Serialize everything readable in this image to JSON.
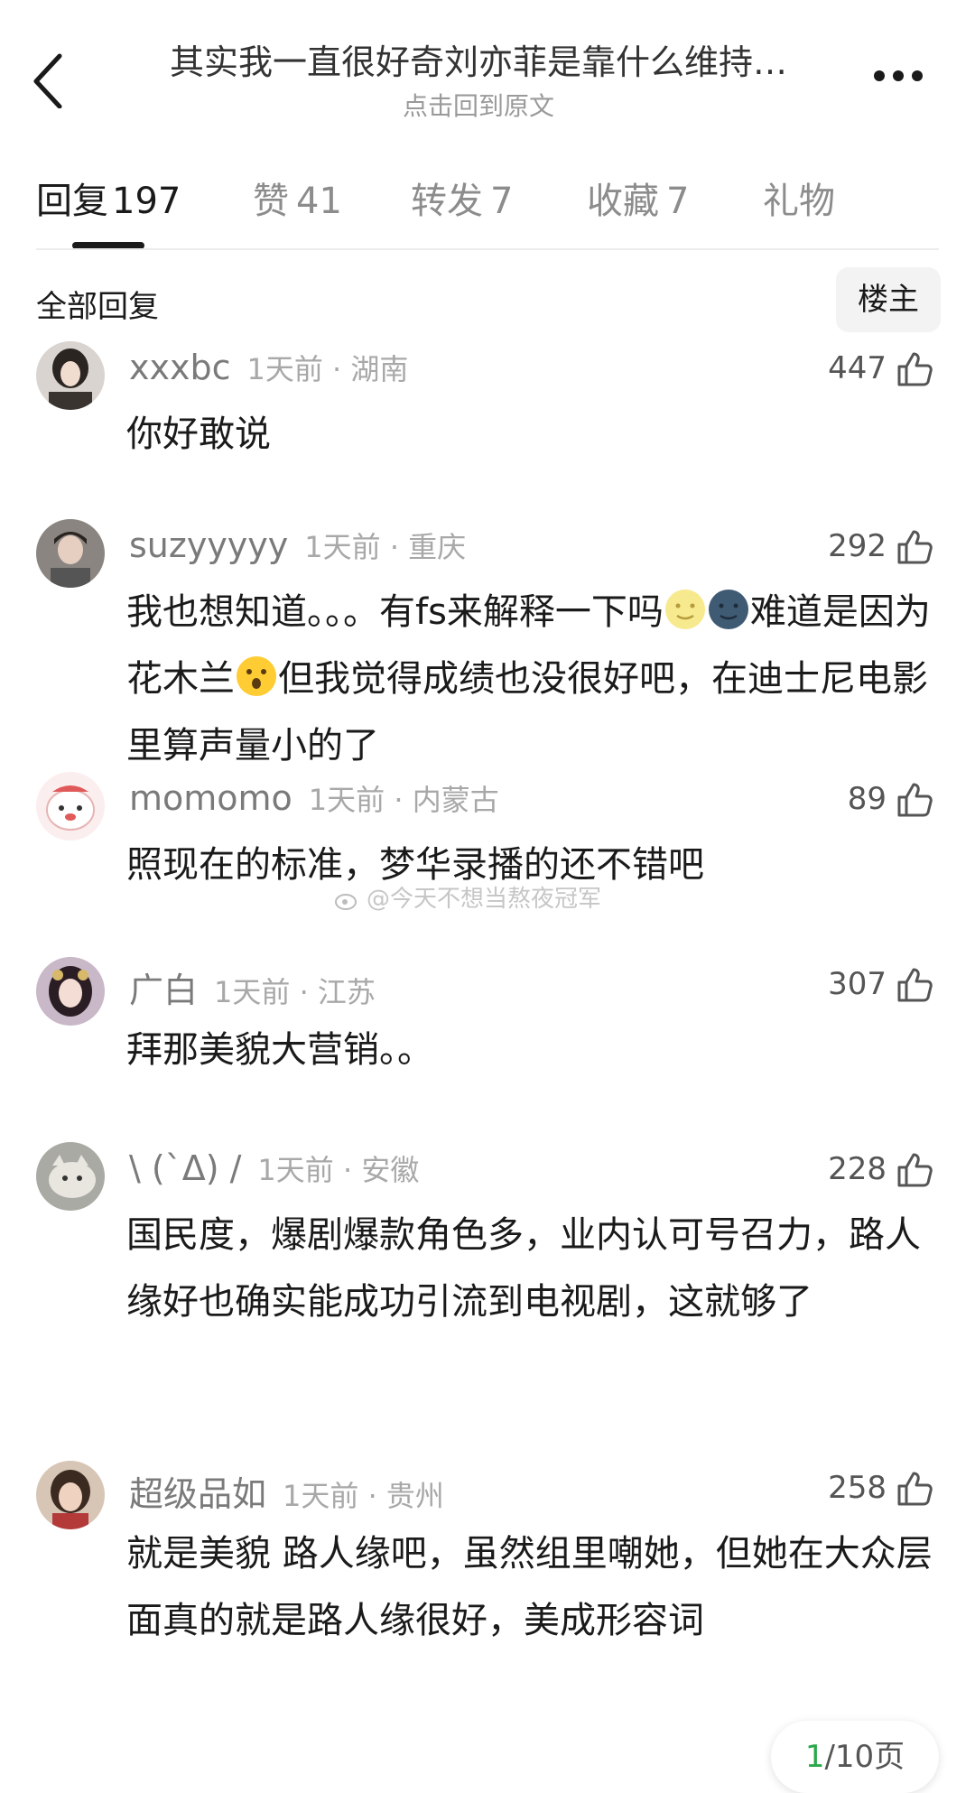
{
  "header": {
    "title": "其实我一直很好奇刘亦菲是靠什么维持…",
    "subtitle": "点击回到原文"
  },
  "tabs": [
    {
      "label": "回复",
      "count": "197"
    },
    {
      "label": "赞",
      "count": "41"
    },
    {
      "label": "转发",
      "count": "7"
    },
    {
      "label": "收藏",
      "count": "7"
    },
    {
      "label": "礼物",
      "count": ""
    }
  ],
  "section": {
    "label": "全部回复",
    "op_button": "楼主"
  },
  "comments": [
    {
      "user": "xxxbc",
      "time": "1天前",
      "location": "湖南",
      "likes": "447",
      "text": "你好敢说"
    },
    {
      "user": "suzyyyyy",
      "time": "1天前",
      "location": "重庆",
      "likes": "292",
      "text_parts": [
        "我也想知道。。。有fs来解释一下吗",
        "难道是因为花木兰",
        "但我觉得成绩也没很好吧，在迪士尼电影里算声量小的了"
      ]
    },
    {
      "user": "momomo",
      "time": "1天前",
      "location": "内蒙古",
      "likes": "89",
      "text": "照现在的标准，梦华录播的还不错吧"
    },
    {
      "user": "广白",
      "time": "1天前",
      "location": "江苏",
      "likes": "307",
      "text": "拜那美貌大营销。。"
    },
    {
      "user": "\\ (`Δ) /",
      "time": "1天前",
      "location": "安徽",
      "likes": "228",
      "text": "国民度，爆剧爆款角色多，业内认可号召力，路人缘好也确实能成功引流到电视剧，这就够了"
    },
    {
      "user": "超级品如",
      "time": "1天前",
      "location": "贵州",
      "likes": "258",
      "text": "就是美貌 路人缘吧，虽然组里嘲她，但她在大众层面真的就是路人缘很好，美成形容词"
    }
  ],
  "watermark": "@今天不想当熬夜冠军",
  "pager": {
    "current": "1",
    "rest": "/10页"
  },
  "colors": {
    "accent_green": "#2aa84a"
  },
  "icons": [
    "back-arrow-icon",
    "more-dots-icon",
    "thumb-up-icon",
    "moon-face-icon",
    "new-moon-face-icon",
    "hushed-face-icon",
    "weibo-logo-icon"
  ]
}
